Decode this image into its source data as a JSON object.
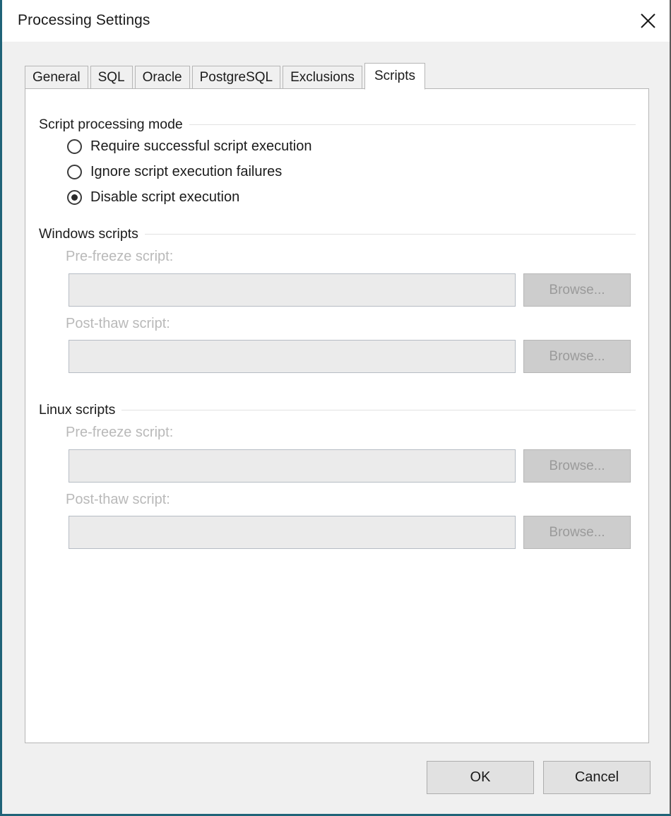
{
  "window": {
    "title": "Processing Settings",
    "close_icon": "close-icon"
  },
  "tabs": [
    {
      "label": "General",
      "active": false
    },
    {
      "label": "SQL",
      "active": false
    },
    {
      "label": "Oracle",
      "active": false
    },
    {
      "label": "PostgreSQL",
      "active": false
    },
    {
      "label": "Exclusions",
      "active": false
    },
    {
      "label": "Scripts",
      "active": true
    }
  ],
  "groups": {
    "script_mode": {
      "title": "Script processing mode"
    },
    "windows_scripts": {
      "title": "Windows scripts"
    },
    "linux_scripts": {
      "title": "Linux scripts"
    }
  },
  "script_mode_options": [
    {
      "label": "Require successful script execution",
      "selected": false
    },
    {
      "label": "Ignore script execution failures",
      "selected": false
    },
    {
      "label": "Disable script execution",
      "selected": true
    }
  ],
  "windows_scripts": {
    "pre_freeze": {
      "label": "Pre-freeze script:",
      "value": "",
      "placeholder": "",
      "browse_label": "Browse...",
      "disabled": true
    },
    "post_thaw": {
      "label": "Post-thaw script:",
      "value": "",
      "placeholder": "",
      "browse_label": "Browse...",
      "disabled": true
    }
  },
  "linux_scripts": {
    "pre_freeze": {
      "label": "Pre-freeze script:",
      "value": "",
      "placeholder": "",
      "browse_label": "Browse...",
      "disabled": true
    },
    "post_thaw": {
      "label": "Post-thaw script:",
      "value": "",
      "placeholder": "",
      "browse_label": "Browse...",
      "disabled": true
    }
  },
  "footer": {
    "ok_label": "OK",
    "cancel_label": "Cancel"
  },
  "colors": {
    "window_bg": "#f0f0f0",
    "panel_bg": "#ffffff",
    "accent_border": "#1f6378",
    "disabled_text": "#b9b9b9",
    "text": "#1b1b1b"
  }
}
